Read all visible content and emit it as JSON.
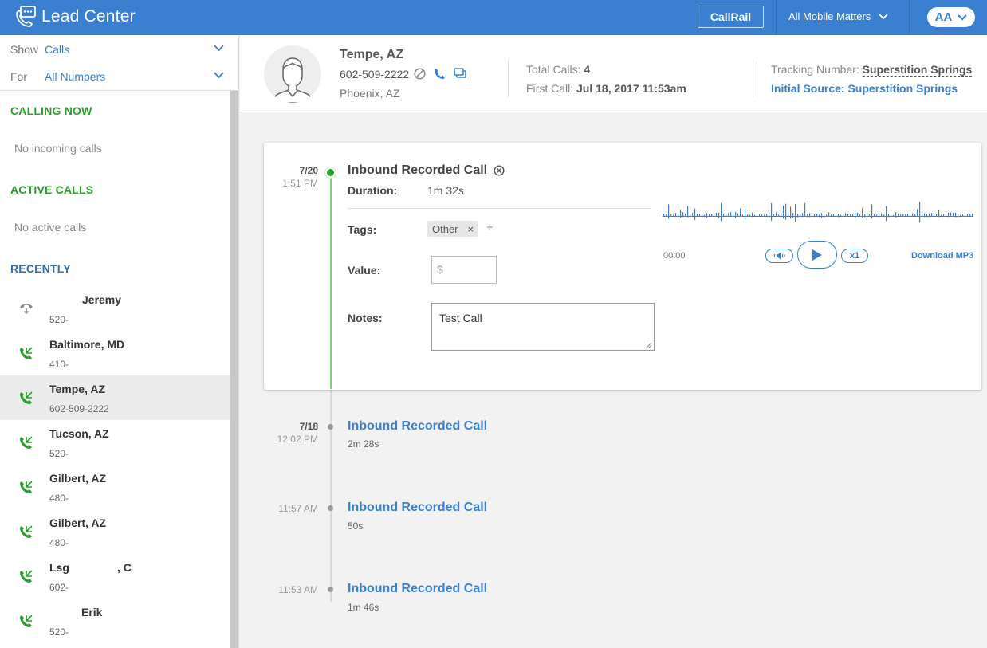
{
  "app": {
    "title": "Lead Center"
  },
  "header": {
    "callrail_label": "CallRail",
    "account_name": "All Mobile Matters",
    "user_initials": "AA"
  },
  "filters": {
    "show_label": "Show",
    "show_value": "Calls",
    "for_label": "For",
    "for_value": "All Numbers"
  },
  "sidebar": {
    "calling_now_title": "CALLING NOW",
    "calling_now_empty": "No incoming calls",
    "active_calls_title": "ACTIVE CALLS",
    "active_calls_empty": "No active calls",
    "recently_title": "RECENTLY",
    "recent": [
      {
        "name": "Jeremy",
        "number": "520-",
        "type": "outbound"
      },
      {
        "name": "Baltimore, MD",
        "number": "410-",
        "type": "inbound"
      },
      {
        "name": "Tempe, AZ",
        "number": "602-509-2222",
        "type": "inbound",
        "selected": true
      },
      {
        "name": "Tucson, AZ",
        "number": "520-",
        "type": "inbound"
      },
      {
        "name": "Gilbert, AZ",
        "number": "480-",
        "type": "inbound"
      },
      {
        "name": "Gilbert, AZ",
        "number": "480-",
        "type": "inbound"
      },
      {
        "name": "Lsg",
        "name_suffix": ", C",
        "number": "602-",
        "type": "inbound"
      },
      {
        "name": "Erik",
        "number": "520-",
        "type": "inbound"
      }
    ]
  },
  "contact": {
    "name": "Tempe, AZ",
    "phone": "602-509-2222",
    "location": "Phoenix, AZ",
    "total_calls_label": "Total Calls:",
    "total_calls_value": "4",
    "first_call_label": "First Call:",
    "first_call_value": "Jul 18, 2017 11:53am",
    "tracking_label": "Tracking Number:",
    "tracking_value": "Superstition Springs",
    "initial_source": "Initial Source: Superstition Springs"
  },
  "timeline": {
    "expanded": {
      "date": "7/20",
      "time": "1:51 PM",
      "title": "Inbound Recorded Call",
      "duration_label": "Duration:",
      "duration_value": "1m 32s",
      "tags_label": "Tags:",
      "tag": "Other",
      "tag_remove": "×",
      "tag_add": "+",
      "value_label": "Value:",
      "value_placeholder": "$",
      "notes_label": "Notes:",
      "notes_value": "Test Call",
      "player_time": "00:00",
      "speed": "x1",
      "download": "Download MP3"
    },
    "calls": [
      {
        "date": "7/18",
        "time": "12:02 PM",
        "title": "Inbound Recorded Call",
        "duration": "2m 28s"
      },
      {
        "date": "",
        "time": "11:57 AM",
        "title": "Inbound Recorded Call",
        "duration": "50s"
      },
      {
        "date": "",
        "time": "11:53 AM",
        "title": "Inbound Recorded Call",
        "duration": "1m 46s"
      }
    ]
  },
  "colors": {
    "brand_blue": "#3a7fd0",
    "green": "#2ca02c"
  }
}
